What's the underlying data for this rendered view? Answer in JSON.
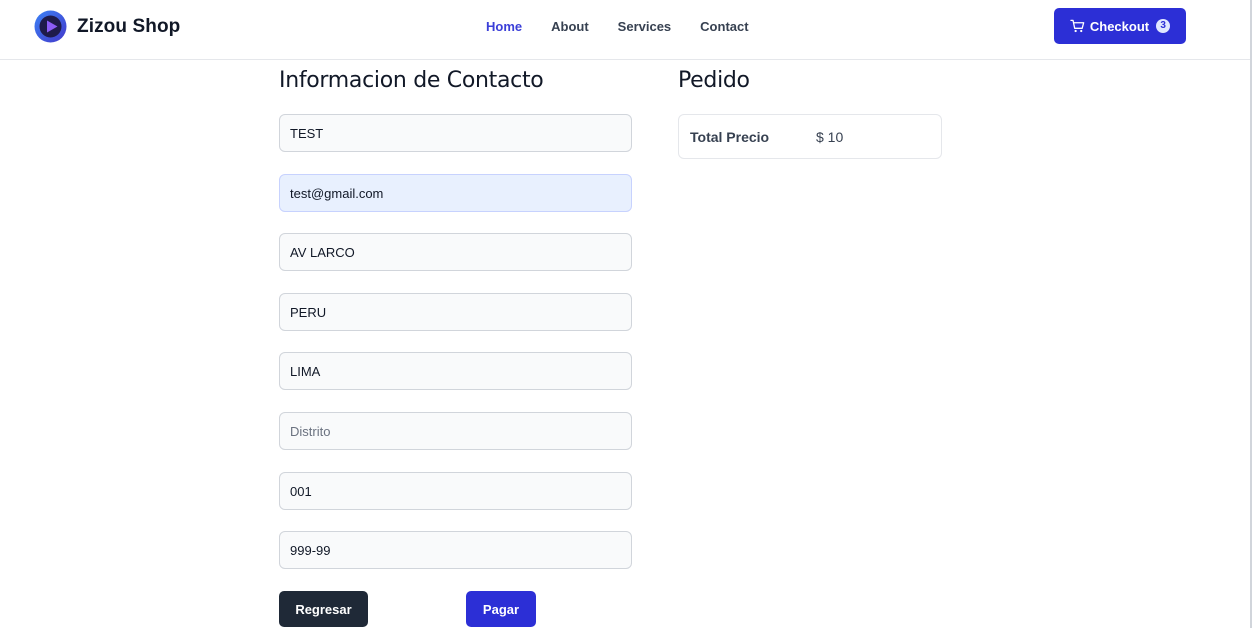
{
  "header": {
    "brand": "Zizou Shop",
    "nav": [
      {
        "label": "Home",
        "active": true
      },
      {
        "label": "About",
        "active": false
      },
      {
        "label": "Services",
        "active": false
      },
      {
        "label": "Contact",
        "active": false
      }
    ],
    "checkout": {
      "label": "Checkout",
      "count": "3",
      "icon": "shopping-cart-icon"
    },
    "logo_icon": "play-logo-icon"
  },
  "contact": {
    "title": "Informacion de Contacto",
    "fields": [
      {
        "value": "TEST",
        "placeholder": ""
      },
      {
        "value": "test@gmail.com",
        "placeholder": ""
      },
      {
        "value": "AV LARCO",
        "placeholder": ""
      },
      {
        "value": "PERU",
        "placeholder": ""
      },
      {
        "value": "LIMA",
        "placeholder": ""
      },
      {
        "value": "",
        "placeholder": "Distrito"
      },
      {
        "value": "001",
        "placeholder": ""
      },
      {
        "value": "999-99",
        "placeholder": ""
      }
    ],
    "back_label": "Regresar",
    "pay_label": "Pagar"
  },
  "order": {
    "title": "Pedido",
    "total_label": "Total Precio",
    "total_value": "$ 10"
  },
  "colors": {
    "accent": "#2c2fd6",
    "dark_button": "#1f2937",
    "active_nav": "#3b3fd8"
  }
}
